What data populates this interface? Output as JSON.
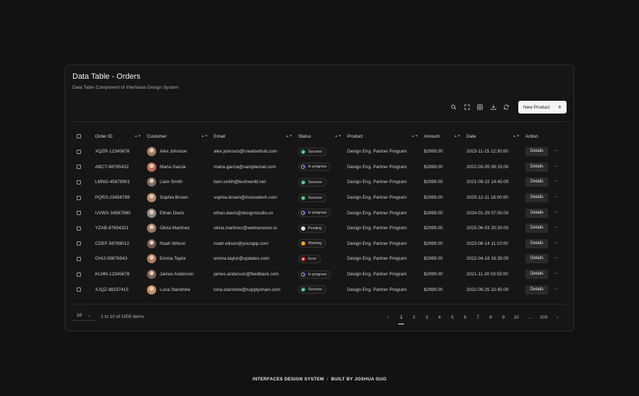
{
  "header": {
    "title": "Data Table - Orders",
    "subtitle": "Data Table Component of Interfaces Design System",
    "new_button": "New Product"
  },
  "columns": [
    "Order ID",
    "Customer",
    "Email",
    "Status",
    "Product",
    "Amount",
    "Date",
    "Action"
  ],
  "rows": [
    {
      "id": "XQZR-12345678",
      "customer": "Alex Johnson",
      "email": "alex.johnson@creativehub.com",
      "status": "Success",
      "product": "Design Eng. Partner Program",
      "amount": "$2999.00",
      "date": "2023-11-15 12:30:00",
      "action": "Details"
    },
    {
      "id": "ABCT-98765432",
      "customer": "Maria Garcia",
      "email": "maria.garcia@samplemail.com",
      "status": "In progress",
      "product": "Design Eng. Partner Program",
      "amount": "$2999.00",
      "date": "2022-03-05 09:15:00",
      "action": "Details"
    },
    {
      "id": "LMNO-45678901",
      "customer": "Liam Smith",
      "email": "liam.smith@techworld.net",
      "status": "Success",
      "product": "Design Eng. Partner Program",
      "amount": "$2999.00",
      "date": "2021-09-22 14:45:00",
      "action": "Details"
    },
    {
      "id": "PQRS-23456789",
      "customer": "Sophia Brown",
      "email": "sophia.brown@innovatech.com",
      "status": "Success",
      "product": "Design Eng. Partner Program",
      "amount": "$2999.00",
      "date": "2020-12-11 18:00:00",
      "action": "Details"
    },
    {
      "id": "UVWX-34567890",
      "customer": "Ethan Davis",
      "email": "ethan.davis@designstudio.co",
      "status": "In progress",
      "product": "Design Eng. Partner Program",
      "amount": "$2999.00",
      "date": "2024-01-29 07:50:00",
      "action": "Details"
    },
    {
      "id": "YZAB-87654321",
      "customer": "Olivia Martinez",
      "email": "olivia.martinez@webservices.io",
      "status": "Pending",
      "product": "Design Eng. Partner Program",
      "amount": "$2999.00",
      "date": "2025-06-03 20:20:00",
      "action": "Details"
    },
    {
      "id": "CDEF-56789012",
      "customer": "Noah Wilson",
      "email": "noah.wilson@yourapp.com",
      "status": "Warning",
      "product": "Design Eng. Partner Program",
      "amount": "$2999.00",
      "date": "2023-08-14 11:10:00",
      "action": "Details"
    },
    {
      "id": "GHIJ-09876543",
      "customer": "Emma Taylor",
      "email": "emma.taylor@updates.com",
      "status": "Error",
      "product": "Design Eng. Partner Program",
      "amount": "$2999.00",
      "date": "2022-04-18 16:35:00",
      "action": "Details"
    },
    {
      "id": "KLMN-12345678",
      "customer": "James Anderson",
      "email": "james.anderson@feedback.com",
      "status": "In progress",
      "product": "Design Eng. Partner Program",
      "amount": "$2999.00",
      "date": "2021-11-30 03:55:00",
      "action": "Details"
    },
    {
      "id": "XJQZ-98237415",
      "customer": "Luna Starshine",
      "email": "luna.starshine@supplychain.com",
      "status": "Success",
      "product": "Design Eng. Partner Program",
      "amount": "$2999.00",
      "date": "2022-09-25 22:45:00",
      "action": "Details"
    }
  ],
  "avatar_colors": [
    "#a07860",
    "#c06a58",
    "#7c6a60",
    "#b08a70",
    "#8a8a8a",
    "#9a7a68",
    "#6e5a50",
    "#b07a60",
    "#7a6258",
    "#c09068"
  ],
  "status_colors": {
    "Success": "#2faa5a",
    "In progress": "#3b5bdb",
    "Pending": "#e6e6e6",
    "Warning": "#f08c00",
    "Error": "#e03131"
  },
  "pagination": {
    "per_page": "10",
    "info": "1 to 10 of 1000 items",
    "pages": [
      "1",
      "2",
      "3",
      "4",
      "5",
      "6",
      "7",
      "8",
      "9",
      "10",
      "...",
      "100"
    ],
    "current": "1"
  },
  "footer": {
    "left": "INTERFACES DESIGN SYSTEM",
    "sep": "/",
    "built": "BUILT BY",
    "author": "JOSHUA GUO"
  }
}
